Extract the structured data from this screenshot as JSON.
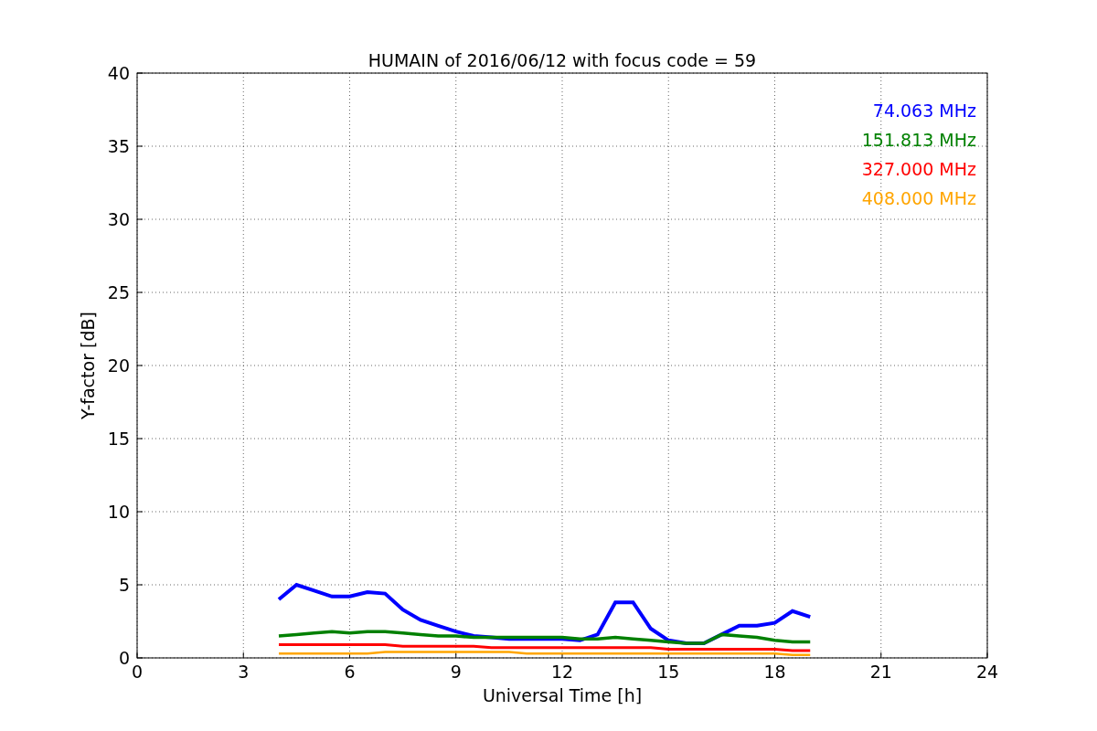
{
  "figure": {
    "chart_data": {
      "type": "line",
      "title": "HUMAIN of 2016/06/12 with focus code = 59",
      "xlabel": "Universal Time [h]",
      "ylabel": "Y-factor [dB]",
      "x": [
        4,
        4.5,
        5,
        5.5,
        6,
        6.5,
        7,
        7.5,
        8,
        8.5,
        9,
        9.5,
        10,
        10.5,
        11,
        11.5,
        12,
        12.5,
        13,
        13.5,
        14,
        14.5,
        15,
        15.5,
        16,
        16.5,
        17,
        17.5,
        18,
        18.5,
        19
      ],
      "series": [
        {
          "name": "74.063 MHz",
          "color": "#0000ff",
          "values": [
            4.0,
            5.0,
            4.6,
            4.2,
            4.2,
            4.5,
            4.4,
            3.3,
            2.6,
            2.2,
            1.8,
            1.5,
            1.4,
            1.3,
            1.3,
            1.3,
            1.3,
            1.2,
            1.6,
            3.8,
            3.8,
            2.0,
            1.2,
            1.0,
            1.0,
            1.6,
            2.2,
            2.2,
            2.4,
            3.2,
            2.8
          ]
        },
        {
          "name": "151.813 MHz",
          "color": "#008000",
          "values": [
            1.5,
            1.6,
            1.7,
            1.8,
            1.7,
            1.8,
            1.8,
            1.7,
            1.6,
            1.5,
            1.5,
            1.4,
            1.4,
            1.4,
            1.4,
            1.4,
            1.4,
            1.3,
            1.3,
            1.4,
            1.3,
            1.2,
            1.1,
            1.0,
            1.0,
            1.6,
            1.5,
            1.4,
            1.2,
            1.1,
            1.1
          ]
        },
        {
          "name": "327.000 MHz",
          "color": "#ff0000",
          "values": [
            0.9,
            0.9,
            0.9,
            0.9,
            0.9,
            0.9,
            0.9,
            0.8,
            0.8,
            0.8,
            0.8,
            0.8,
            0.7,
            0.7,
            0.7,
            0.7,
            0.7,
            0.7,
            0.7,
            0.7,
            0.7,
            0.7,
            0.6,
            0.6,
            0.6,
            0.6,
            0.6,
            0.6,
            0.6,
            0.5,
            0.5
          ]
        },
        {
          "name": "408.000 MHz",
          "color": "#ffa500",
          "values": [
            0.3,
            0.3,
            0.3,
            0.3,
            0.3,
            0.3,
            0.4,
            0.4,
            0.4,
            0.4,
            0.4,
            0.4,
            0.4,
            0.4,
            0.3,
            0.3,
            0.3,
            0.3,
            0.3,
            0.3,
            0.3,
            0.3,
            0.3,
            0.3,
            0.3,
            0.3,
            0.3,
            0.3,
            0.3,
            0.2,
            0.2
          ]
        }
      ],
      "grid": true,
      "xlim": [
        0,
        24
      ],
      "ylim": [
        0,
        40
      ],
      "xticks": [
        0,
        3,
        6,
        9,
        12,
        15,
        18,
        21,
        24
      ],
      "yticks": [
        0,
        5,
        10,
        15,
        20,
        25,
        30,
        35,
        40
      ]
    }
  }
}
